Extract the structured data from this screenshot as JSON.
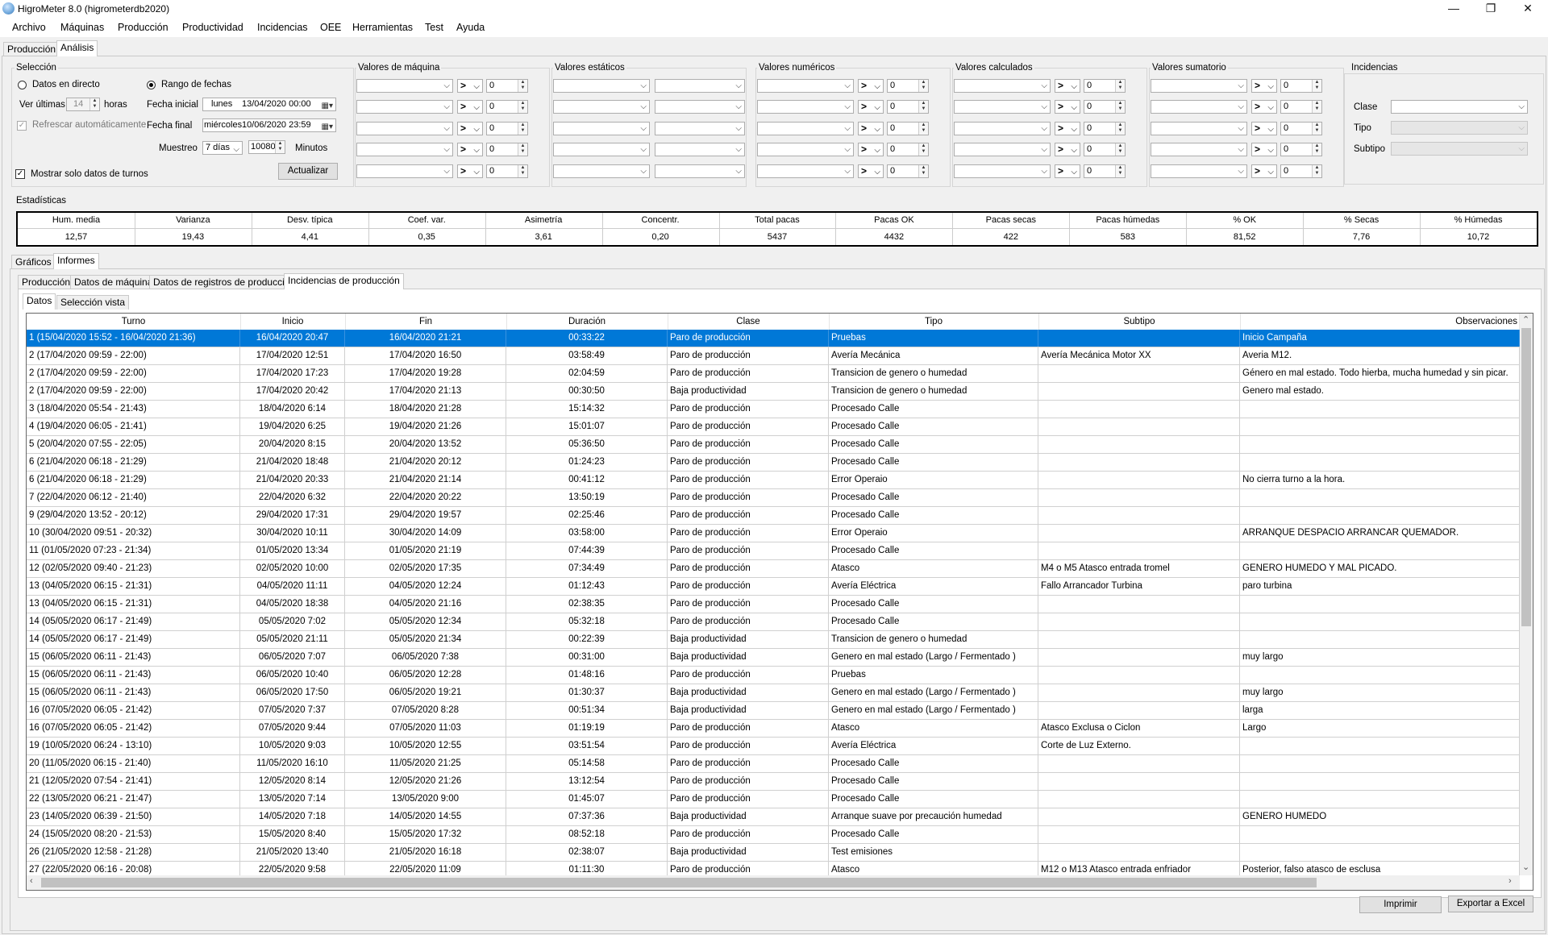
{
  "window": {
    "title": "HigroMeter 8.0 (higrometerdb2020)",
    "minimize": "—",
    "maximize": "❐",
    "close": "✕"
  },
  "menu": [
    "Archivo",
    "Máquinas",
    "Producción",
    "Productividad",
    "Incidencias",
    "OEE",
    "Herramientas",
    "Test",
    "Ayuda"
  ],
  "main_tabs": [
    "Producción",
    "Análisis"
  ],
  "seleccion": {
    "title": "Selección",
    "datos_directo": "Datos en directo",
    "rango_fechas": "Rango de fechas",
    "ver_ultimas": "Ver últimas",
    "horas_value": "14",
    "horas": "horas",
    "refrescar": "Refrescar automáticamente",
    "fecha_inicial_label": "Fecha inicial",
    "fecha_inicial_day": "lunes",
    "fecha_inicial": "13/04/2020 00:00",
    "fecha_final_label": "Fecha final",
    "fecha_final_day": "miércoles",
    "fecha_final": "10/06/2020 23:59",
    "muestreo": "Muestreo",
    "muestreo_value": "7 días",
    "minutos_value": "10080",
    "minutos": "Minutos",
    "actualizar": "Actualizar",
    "mostrar_turnos": "Mostrar solo datos de turnos"
  },
  "filter_groups": [
    "Valores de máquina",
    "Valores estáticos",
    "Valores numéricos",
    "Valores calculados",
    "Valores sumatorio"
  ],
  "filter_op": ">",
  "filter_value": "0",
  "incidencias": {
    "title": "Incidencias",
    "clase": "Clase",
    "tipo": "Tipo",
    "subtipo": "Subtipo"
  },
  "estadisticas": {
    "title": "Estadísticas",
    "headers": [
      "Hum. media",
      "Varianza",
      "Desv. típica",
      "Coef. var.",
      "Asimetría",
      "Concentr.",
      "Total pacas",
      "Pacas OK",
      "Pacas secas",
      "Pacas húmedas",
      "% OK",
      "% Secas",
      "% Húmedas"
    ],
    "values": [
      "12,57",
      "19,43",
      "4,41",
      "0,35",
      "3,61",
      "0,20",
      "5437",
      "4432",
      "422",
      "583",
      "81,52",
      "7,76",
      "10,72"
    ]
  },
  "view_tabs": [
    "Gráficos",
    "Informes"
  ],
  "report_tabs": [
    "Producción",
    "Datos de máquina",
    "Datos de registros de producción",
    "Incidencias de producción"
  ],
  "sub_tabs": [
    "Datos",
    "Selección vista"
  ],
  "grid": {
    "headers": [
      "Turno",
      "Inicio",
      "Fin",
      "Duración",
      "Clase",
      "Tipo",
      "Subtipo",
      "Observaciones"
    ],
    "rows": [
      [
        "1 (15/04/2020 15:52 - 16/04/2020 21:36)",
        "16/04/2020 20:47",
        "16/04/2020 21:21",
        "00:33:22",
        "Paro de producción",
        "Pruebas",
        "",
        "Inicio Campaña"
      ],
      [
        "2 (17/04/2020 09:59 - 22:00)",
        "17/04/2020 12:51",
        "17/04/2020 16:50",
        "03:58:49",
        "Paro de producción",
        "Avería Mecánica",
        "Avería Mecánica Motor XX",
        "Averia M12."
      ],
      [
        "2 (17/04/2020 09:59 - 22:00)",
        "17/04/2020 17:23",
        "17/04/2020 19:28",
        "02:04:59",
        "Paro de producción",
        "Transicion de genero o humedad",
        "",
        "Género en mal estado. Todo hierba, mucha humedad y sin picar."
      ],
      [
        "2 (17/04/2020 09:59 - 22:00)",
        "17/04/2020 20:42",
        "17/04/2020 21:13",
        "00:30:50",
        "Baja productividad",
        "Transicion de genero o humedad",
        "",
        "Genero mal estado."
      ],
      [
        "3 (18/04/2020 05:54 - 21:43)",
        "18/04/2020 6:14",
        "18/04/2020 21:28",
        "15:14:32",
        "Paro de producción",
        "Procesado Calle",
        "",
        ""
      ],
      [
        "4 (19/04/2020 06:05 - 21:41)",
        "19/04/2020 6:25",
        "19/04/2020 21:26",
        "15:01:07",
        "Paro de producción",
        "Procesado Calle",
        "",
        ""
      ],
      [
        "5 (20/04/2020 07:55 - 22:05)",
        "20/04/2020 8:15",
        "20/04/2020 13:52",
        "05:36:50",
        "Paro de producción",
        "Procesado Calle",
        "",
        ""
      ],
      [
        "6 (21/04/2020 06:18 - 21:29)",
        "21/04/2020 18:48",
        "21/04/2020 20:12",
        "01:24:23",
        "Paro de producción",
        "Procesado Calle",
        "",
        ""
      ],
      [
        "6 (21/04/2020 06:18 - 21:29)",
        "21/04/2020 20:33",
        "21/04/2020 21:14",
        "00:41:12",
        "Paro de producción",
        "Error Operaio",
        "",
        "No cierra turno a la hora."
      ],
      [
        "7 (22/04/2020 06:12 - 21:40)",
        "22/04/2020 6:32",
        "22/04/2020 20:22",
        "13:50:19",
        "Paro de producción",
        "Procesado Calle",
        "",
        ""
      ],
      [
        "9 (29/04/2020 13:52 - 20:12)",
        "29/04/2020 17:31",
        "29/04/2020 19:57",
        "02:25:46",
        "Paro de producción",
        "Procesado Calle",
        "",
        ""
      ],
      [
        "10 (30/04/2020 09:51 - 20:32)",
        "30/04/2020 10:11",
        "30/04/2020 14:09",
        "03:58:00",
        "Paro de producción",
        "Error Operaio",
        "",
        "ARRANQUE DESPACIO ARRANCAR QUEMADOR."
      ],
      [
        "11 (01/05/2020 07:23 - 21:34)",
        "01/05/2020 13:34",
        "01/05/2020 21:19",
        "07:44:39",
        "Paro de producción",
        "Procesado Calle",
        "",
        ""
      ],
      [
        "12 (02/05/2020 09:40 - 21:23)",
        "02/05/2020 10:00",
        "02/05/2020 17:35",
        "07:34:49",
        "Paro de producción",
        "Atasco",
        "M4 o M5 Atasco entrada tromel",
        "GENERO HUMEDO  Y MAL PICADO."
      ],
      [
        "13 (04/05/2020 06:15 - 21:31)",
        "04/05/2020 11:11",
        "04/05/2020 12:24",
        "01:12:43",
        "Paro de producción",
        "Avería Eléctrica",
        "Fallo Arrancador Turbina",
        "paro turbina"
      ],
      [
        "13 (04/05/2020 06:15 - 21:31)",
        "04/05/2020 18:38",
        "04/05/2020 21:16",
        "02:38:35",
        "Paro de producción",
        "Procesado Calle",
        "",
        ""
      ],
      [
        "14 (05/05/2020 06:17 - 21:49)",
        "05/05/2020 7:02",
        "05/05/2020 12:34",
        "05:32:18",
        "Paro de producción",
        "Procesado Calle",
        "",
        ""
      ],
      [
        "14 (05/05/2020 06:17 - 21:49)",
        "05/05/2020 21:11",
        "05/05/2020 21:34",
        "00:22:39",
        "Baja productividad",
        "Transicion de genero o humedad",
        "",
        ""
      ],
      [
        "15 (06/05/2020 06:11 - 21:43)",
        "06/05/2020 7:07",
        "06/05/2020 7:38",
        "00:31:00",
        "Baja productividad",
        "Genero en mal estado (Largo /  Fermentado )",
        "",
        "muy largo"
      ],
      [
        "15 (06/05/2020 06:11 - 21:43)",
        "06/05/2020 10:40",
        "06/05/2020 12:28",
        "01:48:16",
        "Paro de producción",
        "Pruebas",
        "",
        ""
      ],
      [
        "15 (06/05/2020 06:11 - 21:43)",
        "06/05/2020 17:50",
        "06/05/2020 19:21",
        "01:30:37",
        "Baja productividad",
        "Genero en mal estado (Largo /  Fermentado )",
        "",
        "muy largo"
      ],
      [
        "16 (07/05/2020 06:05 - 21:42)",
        "07/05/2020 7:37",
        "07/05/2020 8:28",
        "00:51:34",
        "Baja productividad",
        "Genero en mal estado (Largo /  Fermentado )",
        "",
        "larga"
      ],
      [
        "16 (07/05/2020 06:05 - 21:42)",
        "07/05/2020 9:44",
        "07/05/2020 11:03",
        "01:19:19",
        "Paro de producción",
        "Atasco",
        "Atasco Exclusa o Ciclon",
        "Largo"
      ],
      [
        "19 (10/05/2020 06:24 - 13:10)",
        "10/05/2020 9:03",
        "10/05/2020 12:55",
        "03:51:54",
        "Paro de producción",
        "Avería Eléctrica",
        "Corte de Luz Externo.",
        ""
      ],
      [
        "20 (11/05/2020 06:15 - 21:40)",
        "11/05/2020 16:10",
        "11/05/2020 21:25",
        "05:14:58",
        "Paro de producción",
        "Procesado Calle",
        "",
        ""
      ],
      [
        "21 (12/05/2020 07:54 - 21:41)",
        "12/05/2020 8:14",
        "12/05/2020 21:26",
        "13:12:54",
        "Paro de producción",
        "Procesado Calle",
        "",
        ""
      ],
      [
        "22 (13/05/2020 06:21 - 21:47)",
        "13/05/2020 7:14",
        "13/05/2020 9:00",
        "01:45:07",
        "Paro de producción",
        "Procesado Calle",
        "",
        ""
      ],
      [
        "23 (14/05/2020 06:39 - 21:50)",
        "14/05/2020 7:18",
        "14/05/2020 14:55",
        "07:37:36",
        "Baja productividad",
        "Arranque suave por precaución humedad",
        "",
        "GENERO HUMEDO"
      ],
      [
        "24 (15/05/2020 08:20 - 21:53)",
        "15/05/2020 8:40",
        "15/05/2020 17:32",
        "08:52:18",
        "Paro de producción",
        "Procesado Calle",
        "",
        ""
      ],
      [
        "26 (21/05/2020 12:58 - 21:28)",
        "21/05/2020 13:40",
        "21/05/2020 16:18",
        "02:38:07",
        "Baja productividad",
        "Test emisiones",
        "",
        ""
      ],
      [
        "27 (22/05/2020 06:16 - 20:08)",
        "22/05/2020 9:58",
        "22/05/2020 11:09",
        "01:11:30",
        "Paro de producción",
        "Atasco",
        "M12 o M13 Atasco entrada enfriador",
        "Posterior, falso atasco de esclusa"
      ]
    ]
  },
  "buttons": {
    "imprimir": "Imprimir",
    "exportar": "Exportar a Excel"
  },
  "colors": {
    "selection": "#0078d7",
    "background": "#f0f0f0"
  }
}
